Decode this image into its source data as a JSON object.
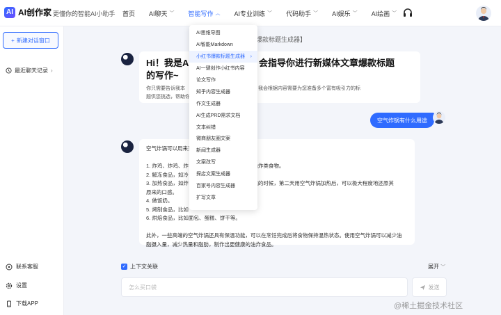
{
  "brand": {
    "logo_mark": "AI",
    "name": "AI创作家",
    "slogan": "更懂你的智能AI小助手"
  },
  "nav": [
    {
      "label": "首页",
      "has_menu": false,
      "active": false
    },
    {
      "label": "AI聊天",
      "has_menu": true,
      "active": false
    },
    {
      "label": "智能写作",
      "has_menu": true,
      "active": true
    },
    {
      "label": "AI专业训练",
      "has_menu": true,
      "active": false
    },
    {
      "label": "代码助手",
      "has_menu": true,
      "active": false
    },
    {
      "label": "AI娱乐",
      "has_menu": true,
      "active": false
    },
    {
      "label": "AI绘画",
      "has_menu": true,
      "active": false
    }
  ],
  "icons": {
    "headset": "headset-icon",
    "user": "user-avatar-icon",
    "chevron": "chevron-down-icon"
  },
  "sidebar": {
    "new_chat": "新建对话窗口",
    "recent": "最近聊天记录",
    "contact": "联系客服",
    "settings": "设置",
    "download": "下载APP"
  },
  "chat": {
    "title_strip": "红书爆款标题生成器】",
    "greeting_title": "Hi！我是AI创作家，我会指导你进行新媒体文章爆款标题的写作~",
    "greeting_title_visible_left": "Hi！我是AI创",
    "greeting_title_visible_right": "会指导你进行新媒体文章爆款标题",
    "greeting_title_line2": "的写作~",
    "greeting_body_left": "你只需要告诉我本",
    "greeting_body_right": "标题，我会根据内容需要为您准备多个富有吸引力的标",
    "greeting_body_line2_left": "题供您挑选，帮助你",
    "user_question": "空气炸锅有什么用途",
    "answer_lines": [
      {
        "left": "空气炸锅可以用来烹",
        "right": ""
      },
      {
        "left": "",
        "right": ""
      },
      {
        "left": "1. 炸鸡、炸鸡、炸",
        "right": "的油炸类食物。"
      },
      {
        "left": "2. 解冻食品，如冷",
        "right": ""
      },
      {
        "left": "3. 加热食品，如炸",
        "right": "不完的时候，第二天用空气炸锅加热后，可以极大程度地还原其"
      },
      {
        "left": "原来的口感。",
        "right": ""
      },
      {
        "left": "4. 做饭奶。",
        "right": ""
      },
      {
        "left": "5. 烤制食品，比如",
        "right": ""
      },
      {
        "left": "6. 烘焙食品，比如面包、蛋糕、饼干等。",
        "right": ""
      },
      {
        "left": "",
        "right": ""
      },
      {
        "left": "此外，一些高端的空气炸锅还具有保温功能，可以在烹饪完成后将食物保持温热状态。使用空气炸锅可以减少油",
        "right": ""
      },
      {
        "left": "脂摄入量，减少热量和脂肪，制作出更健康的油炸食品。",
        "right": ""
      }
    ]
  },
  "composer": {
    "context_label": "上下文关联",
    "context_checked": true,
    "expand_label": "展开",
    "input_placeholder": "怎么买口袋",
    "send_label": "发送"
  },
  "writing_menu": {
    "items": [
      {
        "label": "AI思维导图",
        "hover": false
      },
      {
        "label": "AI智能Markdown",
        "hover": false
      },
      {
        "label": "小红书爆款标题生成器",
        "hover": true
      },
      {
        "label": "AI一键创作小红书内容",
        "hover": false
      },
      {
        "label": "论文写作",
        "hover": false
      },
      {
        "label": "知乎内容生成器",
        "hover": false
      },
      {
        "label": "作文生成器",
        "hover": false
      },
      {
        "label": "AI生成PRD需求文档",
        "hover": false
      },
      {
        "label": "文本纠错",
        "hover": false
      },
      {
        "label": "微商朋友圈文案",
        "hover": false
      },
      {
        "label": "新闻生成器",
        "hover": false
      },
      {
        "label": "文案改写",
        "hover": false
      },
      {
        "label": "探店文案生成器",
        "hover": false
      },
      {
        "label": "百家号内容生成器",
        "hover": false
      },
      {
        "label": "扩写文章",
        "hover": false
      }
    ]
  },
  "watermark": "@稀土掘金技术社区",
  "colors": {
    "accent": "#2f6bff",
    "background": "#f3f5fa"
  }
}
